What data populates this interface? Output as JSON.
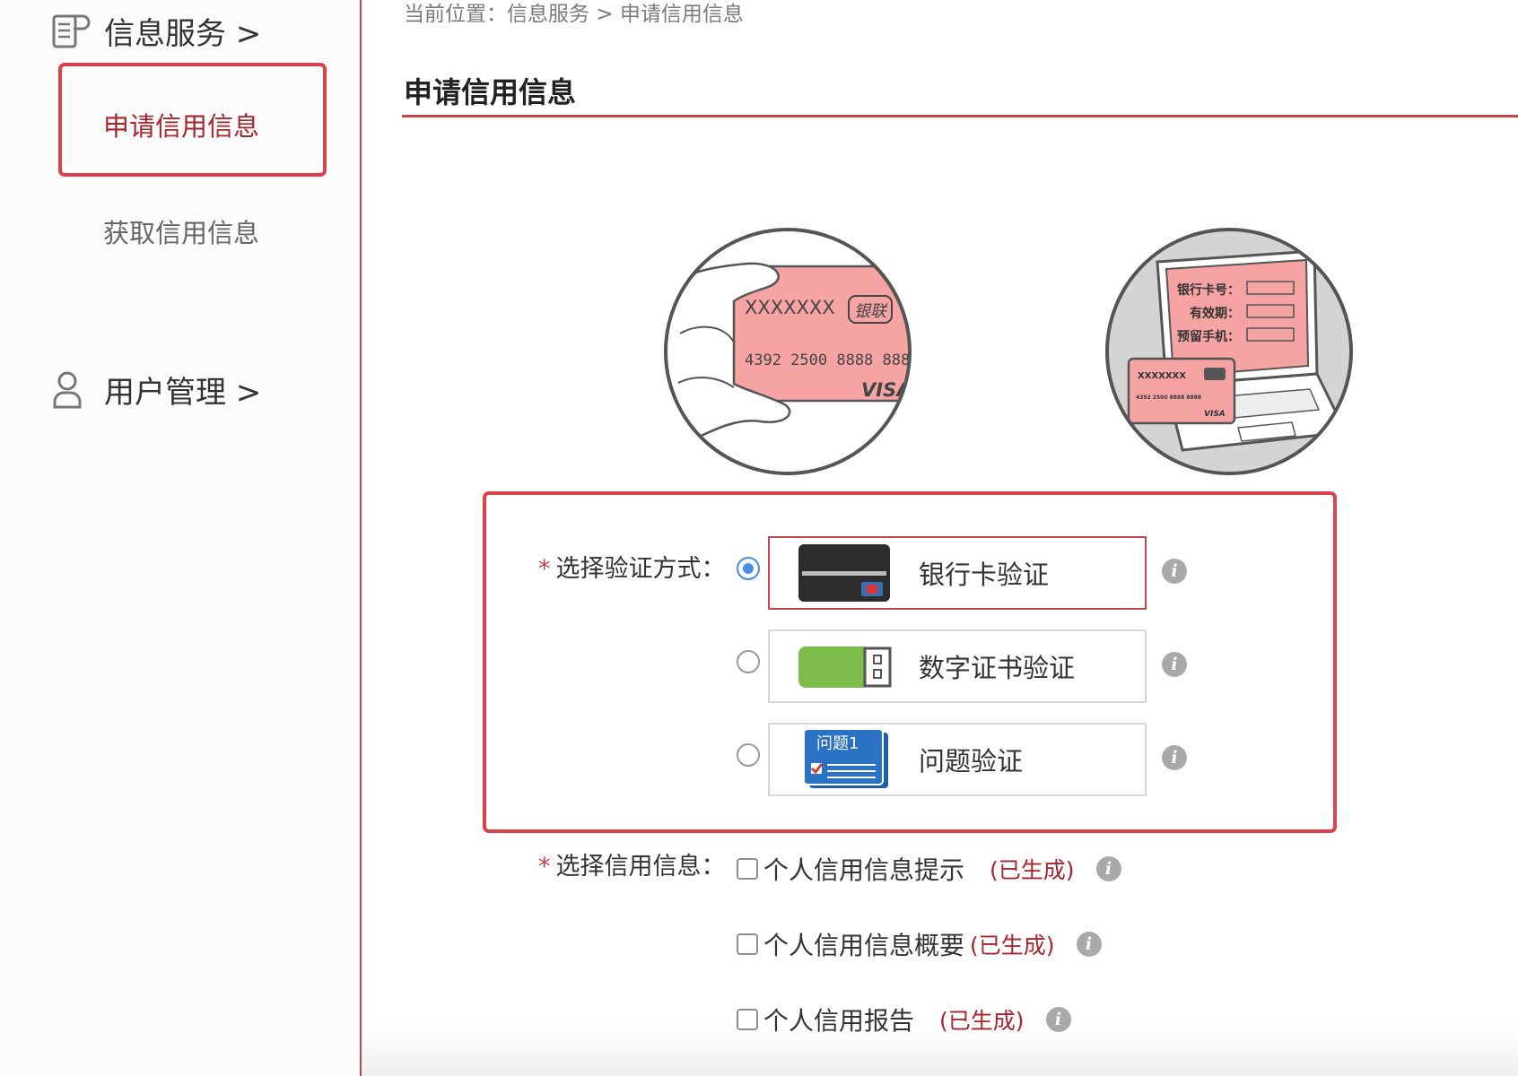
{
  "sidebar": {
    "sections": [
      {
        "title": "信息服务 >",
        "icon": "document-icon"
      },
      {
        "title": "用户管理 >",
        "icon": "user-icon"
      }
    ],
    "items": [
      {
        "label": "申请信用信息",
        "active": true
      },
      {
        "label": "获取信用信息",
        "active": false
      }
    ]
  },
  "breadcrumb": "当前位置：信息服务 > 申请信用信息",
  "page_title": "申请信用信息",
  "illustrations": {
    "card": {
      "name": "XXXXXXX",
      "bank": "银联",
      "number": "4392 2500 8888 888",
      "brand": "VISA"
    },
    "laptop": {
      "field1": "银行卡号：",
      "field2": "有效期：",
      "field3": "预留手机：",
      "card_name": "XXXXXXX",
      "card_number": "4392 2500 8888 8888",
      "card_brand": "VISA"
    }
  },
  "verification": {
    "required_mark": "*",
    "label": "选择验证方式：",
    "options": [
      {
        "label": "银行卡验证",
        "selected": true,
        "icon": "bank-card-icon"
      },
      {
        "label": "数字证书验证",
        "selected": false,
        "icon": "usb-key-icon"
      },
      {
        "label": "问题验证",
        "selected": false,
        "icon": "question-card-icon",
        "icon_text": "问题1"
      }
    ]
  },
  "credit_info": {
    "required_mark": "*",
    "label": "选择信用信息：",
    "options": [
      {
        "label": "个人信用信息提示",
        "status": "(已生成)"
      },
      {
        "label": "个人信用信息概要",
        "status": "(已生成)"
      },
      {
        "label": "个人信用报告",
        "status": "(已生成)"
      }
    ]
  },
  "info_glyph": "i",
  "colors": {
    "accent": "#c9434b",
    "radio_checked": "#4a8fe0",
    "status_text": "#a3262d"
  }
}
